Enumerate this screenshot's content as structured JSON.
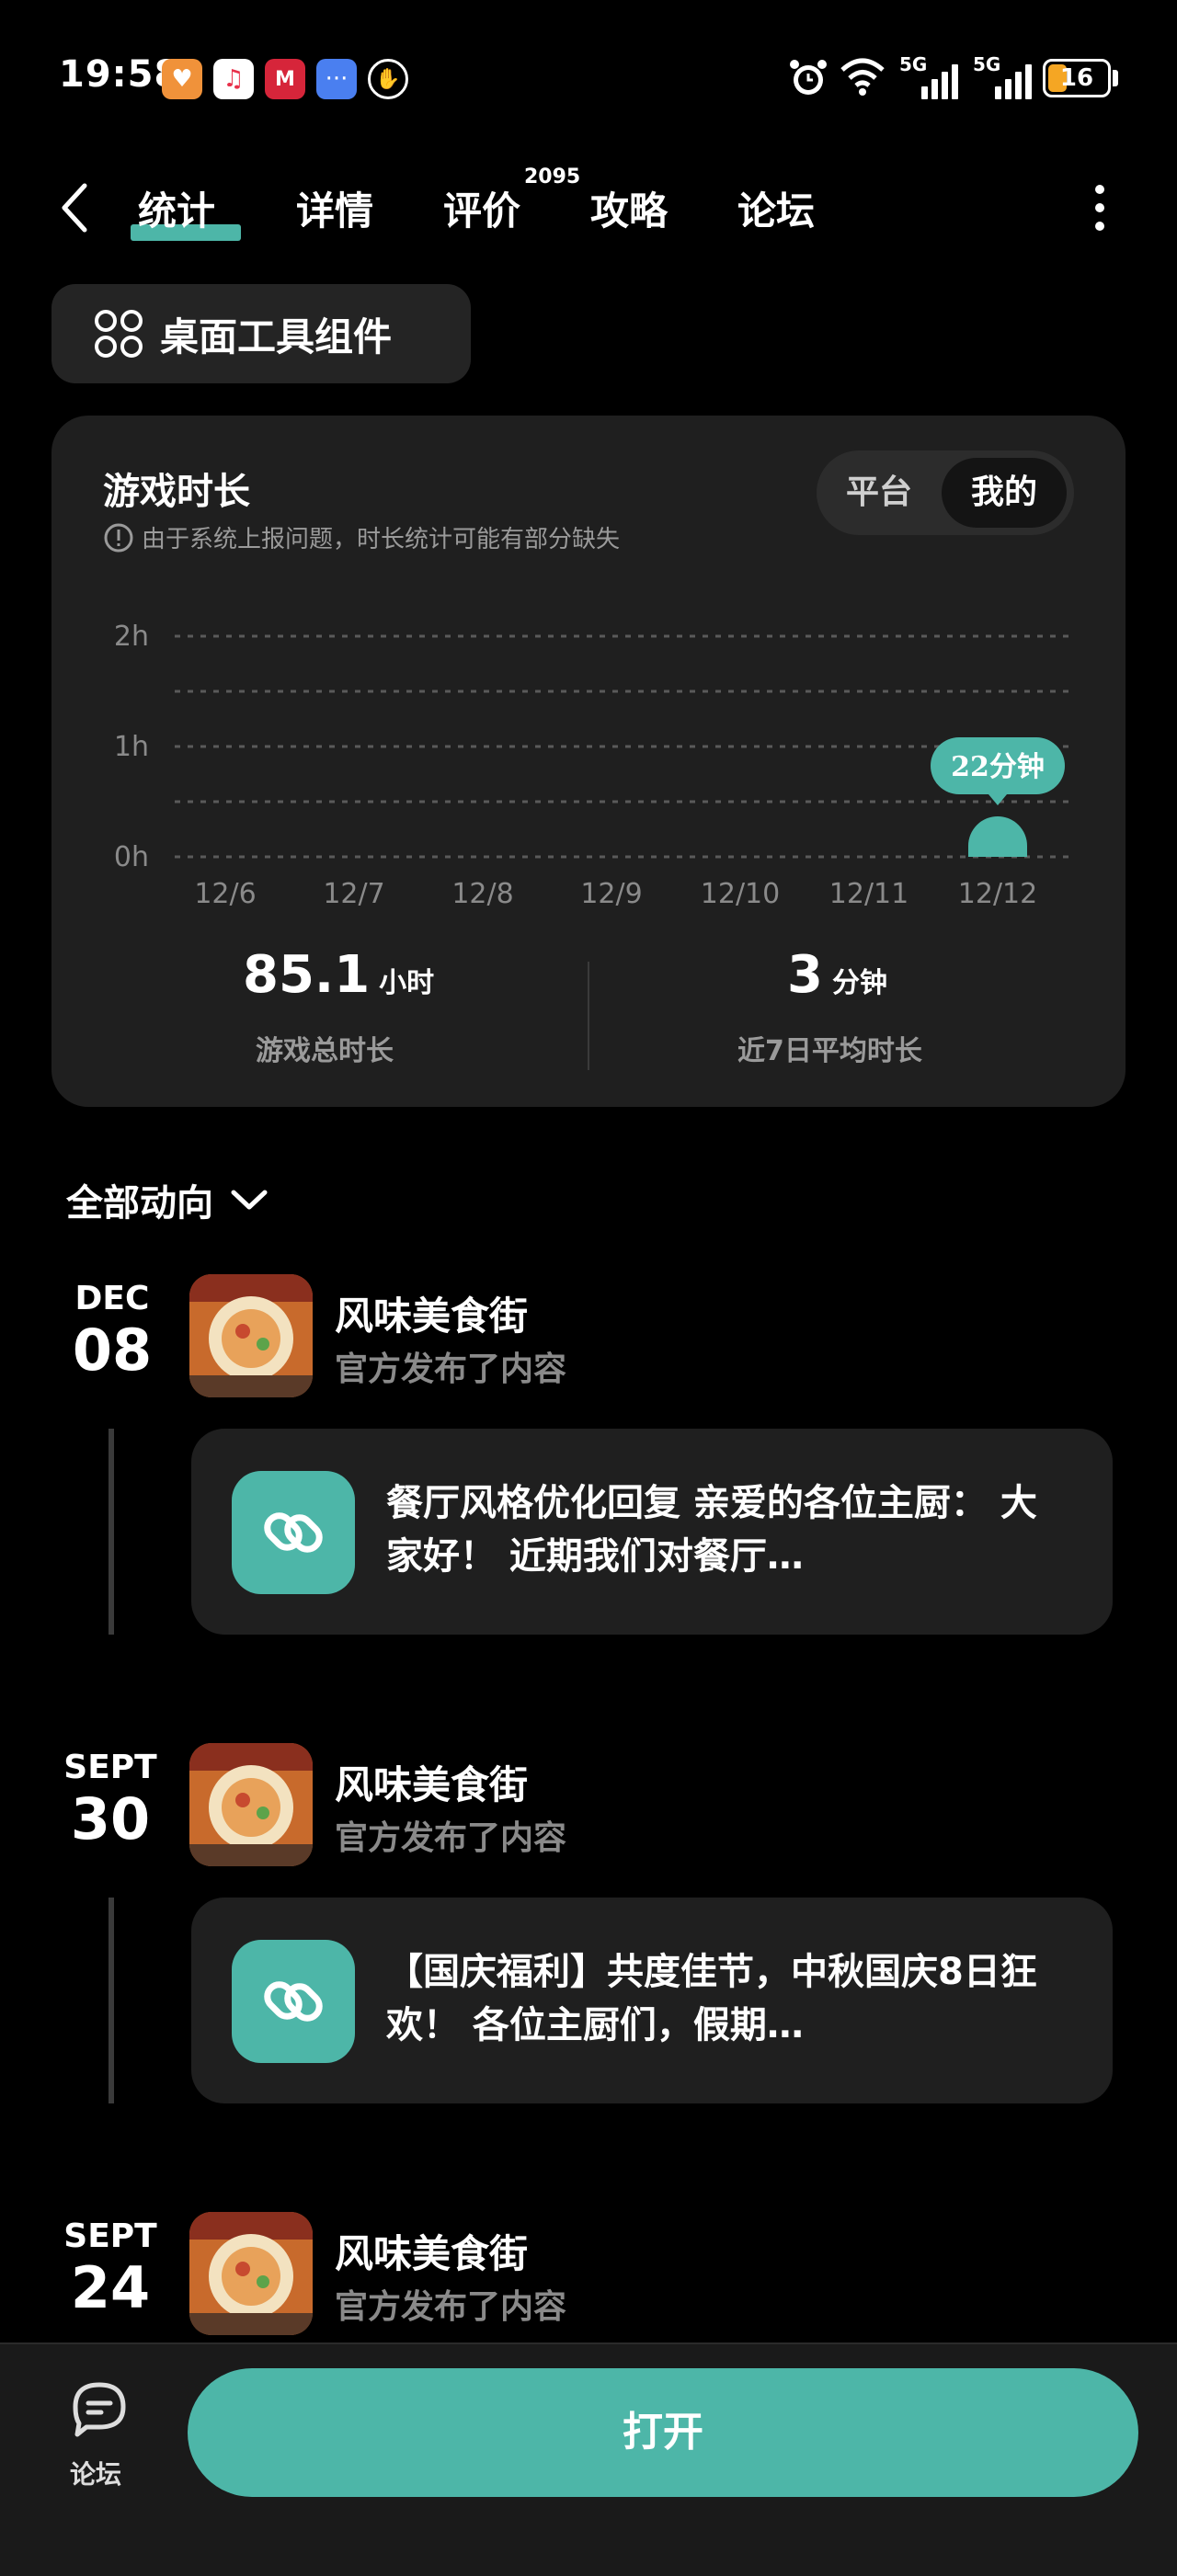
{
  "status_bar": {
    "time": "19:58",
    "battery": "16",
    "net1": "5G",
    "net2": "5G"
  },
  "nav": {
    "back_icon": "chevron-left",
    "tabs": [
      {
        "label": "统计",
        "active": true
      },
      {
        "label": "详情",
        "active": false
      },
      {
        "label": "评价",
        "active": false,
        "badge": "2095"
      },
      {
        "label": "攻略",
        "active": false
      },
      {
        "label": "论坛",
        "active": false
      }
    ],
    "more_icon": "more-vertical"
  },
  "widget_button": {
    "label": "桌面工具组件",
    "icon": "grid-icon"
  },
  "stats": {
    "title": "游戏时长",
    "note": "由于系统上报问题，时长统计可能有部分缺失",
    "toggle": {
      "options": [
        "平台",
        "我的"
      ],
      "selected": "我的"
    },
    "total": {
      "value": "85.1",
      "unit": "小时",
      "label": "游戏总时长"
    },
    "average": {
      "value": "3",
      "unit": "分钟",
      "label": "近7日平均时长"
    }
  },
  "chart_data": {
    "type": "bar",
    "categories": [
      "12/6",
      "12/7",
      "12/8",
      "12/9",
      "12/10",
      "12/11",
      "12/12"
    ],
    "values": [
      0,
      0,
      0,
      0,
      0,
      0,
      22
    ],
    "value_unit": "minutes",
    "y_ticks": [
      "0h",
      "1h",
      "2h"
    ],
    "ylim": [
      0,
      120
    ],
    "grid": true,
    "bar_color": "#4db6a8",
    "tooltip": {
      "index": 6,
      "label": "22分钟"
    }
  },
  "feed": {
    "filter_label": "全部动向",
    "items": [
      {
        "month": "DEC",
        "day": "08",
        "game": "风味美食街",
        "action": "官方发布了内容",
        "post": "餐厅风格优化回复 亲爱的各位主厨： 大家好！ 近期我们对餐厅…"
      },
      {
        "month": "SEPT",
        "day": "30",
        "game": "风味美食街",
        "action": "官方发布了内容",
        "post": "【国庆福利】共度佳节，中秋国庆8日狂欢！ 各位主厨们，假期…"
      },
      {
        "month": "SEPT",
        "day": "24",
        "game": "风味美食街",
        "action": "官方发布了内容"
      }
    ]
  },
  "bottom_bar": {
    "forum_label": "论坛",
    "open_label": "打开"
  },
  "colors": {
    "accent": "#4db6a8",
    "card": "#1f1f1f",
    "background": "#000000"
  }
}
